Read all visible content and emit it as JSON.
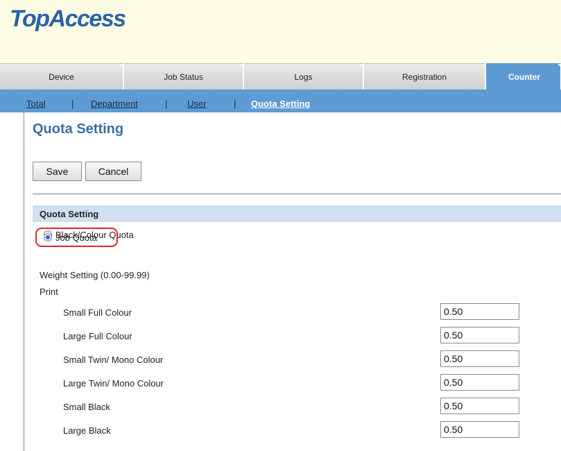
{
  "app": {
    "logo_text": "TopAccess"
  },
  "tabs": [
    {
      "label": "Device"
    },
    {
      "label": "Job Status"
    },
    {
      "label": "Logs"
    },
    {
      "label": "Registration"
    },
    {
      "label": "Counter"
    }
  ],
  "subnav": {
    "items": [
      {
        "label": "Total"
      },
      {
        "label": "Department"
      },
      {
        "label": "User"
      },
      {
        "label": "Quota Setting"
      }
    ],
    "separator": "|"
  },
  "page": {
    "title": "Quota Setting",
    "save_label": "Save",
    "cancel_label": "Cancel"
  },
  "section": {
    "title": "Quota Setting",
    "radio_options": [
      {
        "label": "Black/Colour Quota",
        "checked": false
      },
      {
        "label": "Job Quota",
        "checked": true
      }
    ],
    "weight_setting_label": "Weight Setting (0.00-99.99)",
    "print_label": "Print",
    "rows": [
      {
        "label": "Small Full Colour",
        "value": "0.50"
      },
      {
        "label": "Large Full Colour",
        "value": "0.50"
      },
      {
        "label": "Small Twin/ Mono Colour",
        "value": "0.50"
      },
      {
        "label": "Large Twin/ Mono Colour",
        "value": "0.50"
      },
      {
        "label": "Small Black",
        "value": "0.50"
      },
      {
        "label": "Large Black",
        "value": "0.50"
      }
    ]
  },
  "colors": {
    "accent": "#5e9bd4",
    "title_blue": "#3b6ea5",
    "section_bar": "#cfe0f0",
    "highlight": "#e0242a",
    "header_bg": "#fdfde6"
  }
}
